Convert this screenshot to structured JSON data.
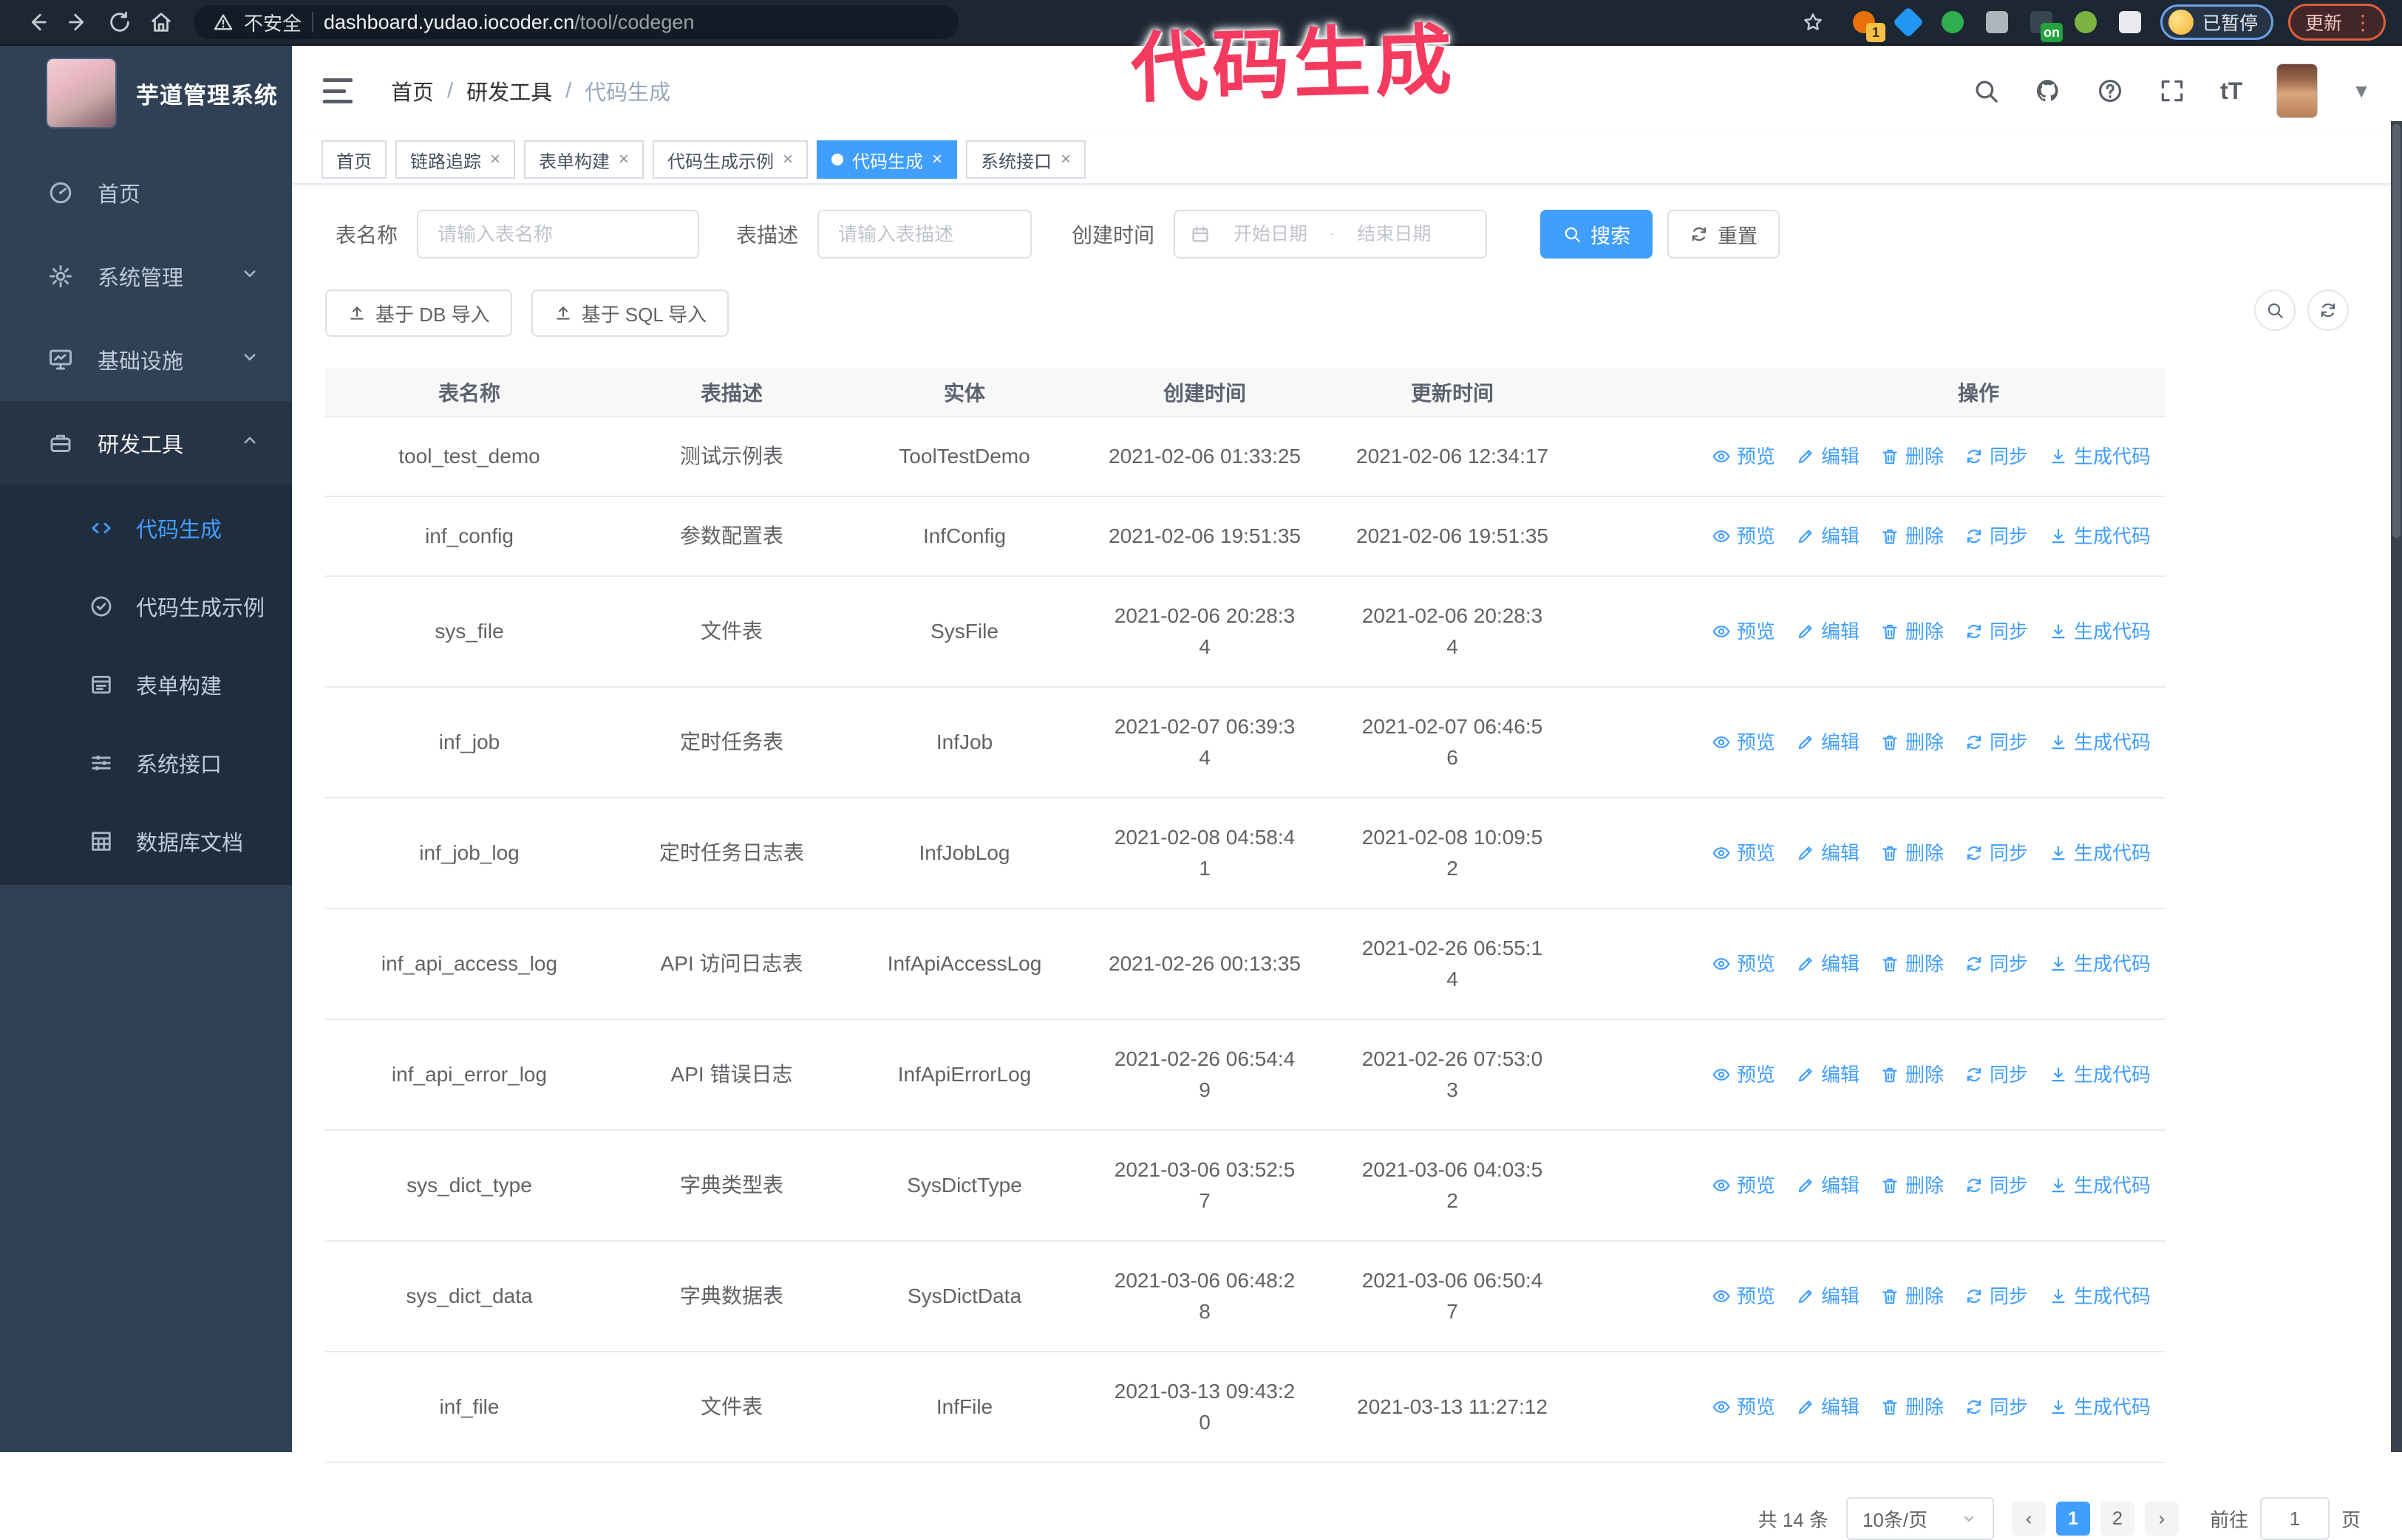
{
  "browser": {
    "insecure_label": "不安全",
    "url_host": "dashboard.yudao.iocoder.cn",
    "url_path": "/tool/codegen",
    "paused_badge": "已暂停",
    "update_button": "更新",
    "extensions": [
      {
        "name": "extension-orange",
        "color": "#e8710a",
        "shape": "circle",
        "badge": "1",
        "badge_color": "yellow"
      },
      {
        "name": "extension-blue-gem",
        "color": "#2196f3",
        "shape": "diamond",
        "badge": ""
      },
      {
        "name": "extension-green-check",
        "color": "#2eae4f",
        "shape": "circle",
        "badge": ""
      },
      {
        "name": "extension-grid",
        "color": "#aeb4bc",
        "shape": "square",
        "badge": ""
      },
      {
        "name": "extension-dark-on",
        "color": "#37474f",
        "shape": "square",
        "badge": "on",
        "badge_color": "green"
      },
      {
        "name": "extension-green-key",
        "color": "#7cb342",
        "shape": "circle",
        "badge": ""
      },
      {
        "name": "extension-puzzle",
        "color": "#e8eaed",
        "shape": "puzzle",
        "badge": ""
      }
    ]
  },
  "annotation": {
    "text": "代码生成",
    "color": "#f43b5f"
  },
  "sidebar": {
    "logo_title": "芋道管理系统",
    "items": [
      {
        "label": "首页",
        "icon": "dashboard-icon",
        "chevron": "",
        "active": false
      },
      {
        "label": "系统管理",
        "icon": "gear-icon",
        "chevron": "down",
        "active": false
      },
      {
        "label": "基础设施",
        "icon": "monitor-icon",
        "chevron": "down",
        "active": false
      },
      {
        "label": "研发工具",
        "icon": "toolbox-icon",
        "chevron": "up",
        "active": true
      }
    ],
    "submenu": [
      {
        "label": "代码生成",
        "icon": "code-icon",
        "active": true
      },
      {
        "label": "代码生成示例",
        "icon": "example-icon",
        "active": false
      },
      {
        "label": "表单构建",
        "icon": "form-icon",
        "active": false
      },
      {
        "label": "系统接口",
        "icon": "api-icon",
        "active": false
      },
      {
        "label": "数据库文档",
        "icon": "database-icon",
        "active": false
      }
    ]
  },
  "header": {
    "breadcrumb": [
      "首页",
      "研发工具",
      "代码生成"
    ],
    "font_size_icon_label": "tT"
  },
  "tabs": [
    {
      "label": "首页",
      "closable": false,
      "active": false
    },
    {
      "label": "链路追踪",
      "closable": true,
      "active": false
    },
    {
      "label": "表单构建",
      "closable": true,
      "active": false
    },
    {
      "label": "代码生成示例",
      "closable": true,
      "active": false
    },
    {
      "label": "代码生成",
      "closable": true,
      "active": true
    },
    {
      "label": "系统接口",
      "closable": true,
      "active": false
    }
  ],
  "filters": {
    "name_label": "表名称",
    "name_placeholder": "请输入表名称",
    "desc_label": "表描述",
    "desc_placeholder": "请输入表描述",
    "time_label": "创建时间",
    "start_placeholder": "开始日期",
    "range_separator": "-",
    "end_placeholder": "结束日期",
    "search_label": "搜索",
    "reset_label": "重置"
  },
  "toolbar": {
    "db_import_label": "基于 DB 导入",
    "sql_import_label": "基于 SQL 导入"
  },
  "table": {
    "headers": [
      "表名称",
      "表描述",
      "实体",
      "创建时间",
      "更新时间",
      "操作"
    ],
    "row_actions": [
      "预览",
      "编辑",
      "删除",
      "同步",
      "生成代码"
    ],
    "rows": [
      {
        "name": "tool_test_demo",
        "desc": "测试示例表",
        "entity": "ToolTestDemo",
        "created": [
          "2021-02-06 01:33:25"
        ],
        "updated": [
          "2021-02-06 12:34:17"
        ]
      },
      {
        "name": "inf_config",
        "desc": "参数配置表",
        "entity": "InfConfig",
        "created": [
          "2021-02-06 19:51:35"
        ],
        "updated": [
          "2021-02-06 19:51:35"
        ]
      },
      {
        "name": "sys_file",
        "desc": "文件表",
        "entity": "SysFile",
        "created": [
          "2021-02-06 20:28:3",
          "4"
        ],
        "updated": [
          "2021-02-06 20:28:3",
          "4"
        ]
      },
      {
        "name": "inf_job",
        "desc": "定时任务表",
        "entity": "InfJob",
        "created": [
          "2021-02-07 06:39:3",
          "4"
        ],
        "updated": [
          "2021-02-07 06:46:5",
          "6"
        ]
      },
      {
        "name": "inf_job_log",
        "desc": "定时任务日志表",
        "entity": "InfJobLog",
        "created": [
          "2021-02-08 04:58:4",
          "1"
        ],
        "updated": [
          "2021-02-08 10:09:5",
          "2"
        ]
      },
      {
        "name": "inf_api_access_log",
        "desc": "API 访问日志表",
        "entity": "InfApiAccessLog",
        "created": [
          "2021-02-26 00:13:35"
        ],
        "updated": [
          "2021-02-26 06:55:1",
          "4"
        ]
      },
      {
        "name": "inf_api_error_log",
        "desc": "API 错误日志",
        "entity": "InfApiErrorLog",
        "created": [
          "2021-02-26 06:54:4",
          "9"
        ],
        "updated": [
          "2021-02-26 07:53:0",
          "3"
        ]
      },
      {
        "name": "sys_dict_type",
        "desc": "字典类型表",
        "entity": "SysDictType",
        "created": [
          "2021-03-06 03:52:5",
          "7"
        ],
        "updated": [
          "2021-03-06 04:03:5",
          "2"
        ]
      },
      {
        "name": "sys_dict_data",
        "desc": "字典数据表",
        "entity": "SysDictData",
        "created": [
          "2021-03-06 06:48:2",
          "8"
        ],
        "updated": [
          "2021-03-06 06:50:4",
          "7"
        ]
      },
      {
        "name": "inf_file",
        "desc": "文件表",
        "entity": "InfFile",
        "created": [
          "2021-03-13 09:43:2",
          "0"
        ],
        "updated": [
          "2021-03-13 11:27:12"
        ]
      }
    ]
  },
  "pagination": {
    "total_label": "共 14 条",
    "page_size_label": "10条/页",
    "pages": [
      "1",
      "2"
    ],
    "current_page": "1",
    "goto_label": "前往",
    "goto_value": "1",
    "goto_suffix": "页"
  },
  "colors": {
    "primary": "#409EFF",
    "annotation": "#F43B5F",
    "sidebar_bg": "#304156",
    "submenu_bg": "#1F2D3D"
  }
}
